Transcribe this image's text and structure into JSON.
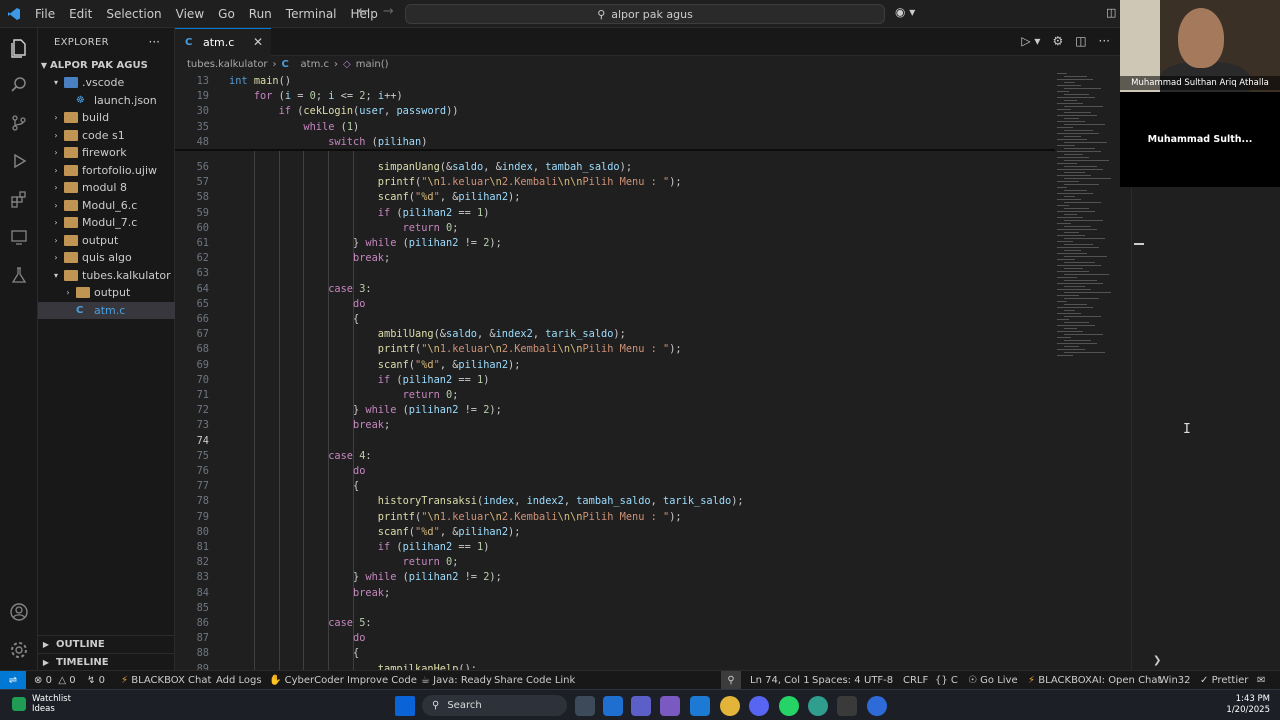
{
  "titlebar": {
    "menu": [
      "File",
      "Edit",
      "Selection",
      "View",
      "Go",
      "Run",
      "Terminal",
      "Help"
    ],
    "search": "alpor pak agus"
  },
  "explorer": {
    "title": "EXPLORER",
    "workspace": "ALPOR PAK AGUS",
    "items": [
      {
        "label": ".vscode",
        "kind": "vsfolder",
        "depth": 1,
        "expanded": true
      },
      {
        "label": "launch.json",
        "kind": "json",
        "depth": 2
      },
      {
        "label": "build",
        "kind": "folder",
        "depth": 1
      },
      {
        "label": "code s1",
        "kind": "folder",
        "depth": 1
      },
      {
        "label": "firework",
        "kind": "folder",
        "depth": 1
      },
      {
        "label": "fortofolio.ujiw",
        "kind": "folder",
        "depth": 1
      },
      {
        "label": "modul 8",
        "kind": "folder",
        "depth": 1
      },
      {
        "label": "Modul_6.c",
        "kind": "folder",
        "depth": 1
      },
      {
        "label": "Modul_7.c",
        "kind": "folder",
        "depth": 1
      },
      {
        "label": "output",
        "kind": "folder",
        "depth": 1
      },
      {
        "label": "quis algo",
        "kind": "folder",
        "depth": 1
      },
      {
        "label": "tubes.kalkulator",
        "kind": "folder",
        "depth": 1,
        "expanded": true
      },
      {
        "label": "output",
        "kind": "folder",
        "depth": 2
      },
      {
        "label": "atm.c",
        "kind": "c",
        "depth": 2,
        "selected": true
      }
    ],
    "outline": "OUTLINE",
    "timeline": "TIMELINE"
  },
  "tab": {
    "label": "atm.c"
  },
  "breadcrumb": {
    "folder": "tubes.kalkulator",
    "file": "atm.c",
    "symbol": "main()"
  },
  "editor": {
    "current_line": 74,
    "sticky": [
      {
        "n": "13",
        "text": "int main()"
      },
      {
        "n": "19",
        "text": "    for (i = 0; i <= 2; i++)"
      },
      {
        "n": "30",
        "text": "        if (cekLogin(user, password))"
      },
      {
        "n": "35",
        "text": "            while (1)"
      },
      {
        "n": "48",
        "text": "                switch (pilihan)"
      }
    ],
    "lines": [
      {
        "n": "56",
        "text": "                        simpanUang(&saldo, &index, tambah_saldo);"
      },
      {
        "n": "57",
        "text": "                        printf(\"\\n1.keluar\\n2.Kembali\\n\\nPilih Menu : \");"
      },
      {
        "n": "58",
        "text": "                        scanf(\"%d\", &pilihan2);"
      },
      {
        "n": "59",
        "text": "                        if (pilihan2 == 1)"
      },
      {
        "n": "60",
        "text": "                            return 0;"
      },
      {
        "n": "61",
        "text": "                    } while (pilihan2 != 2);"
      },
      {
        "n": "62",
        "text": "                    break;"
      },
      {
        "n": "63",
        "text": ""
      },
      {
        "n": "64",
        "text": "                case 3:"
      },
      {
        "n": "65",
        "text": "                    do"
      },
      {
        "n": "66",
        "text": "                    {"
      },
      {
        "n": "67",
        "text": "                        ambilUang(&saldo, &index2, tarik_saldo);"
      },
      {
        "n": "68",
        "text": "                        printf(\"\\n1.keluar\\n2.Kembali\\n\\nPilih Menu : \");"
      },
      {
        "n": "69",
        "text": "                        scanf(\"%d\", &pilihan2);"
      },
      {
        "n": "70",
        "text": "                        if (pilihan2 == 1)"
      },
      {
        "n": "71",
        "text": "                            return 0;"
      },
      {
        "n": "72",
        "text": "                    } while (pilihan2 != 2);"
      },
      {
        "n": "73",
        "text": "                    break;"
      },
      {
        "n": "74",
        "text": ""
      },
      {
        "n": "75",
        "text": "                case 4:"
      },
      {
        "n": "76",
        "text": "                    do"
      },
      {
        "n": "77",
        "text": "                    {"
      },
      {
        "n": "78",
        "text": "                        historyTransaksi(index, index2, tambah_saldo, tarik_saldo);"
      },
      {
        "n": "79",
        "text": "                        printf(\"\\n1.keluar\\n2.Kembali\\n\\nPilih Menu : \");"
      },
      {
        "n": "80",
        "text": "                        scanf(\"%d\", &pilihan2);"
      },
      {
        "n": "81",
        "text": "                        if (pilihan2 == 1)"
      },
      {
        "n": "82",
        "text": "                            return 0;"
      },
      {
        "n": "83",
        "text": "                    } while (pilihan2 != 2);"
      },
      {
        "n": "84",
        "text": "                    break;"
      },
      {
        "n": "85",
        "text": ""
      },
      {
        "n": "86",
        "text": "                case 5:"
      },
      {
        "n": "87",
        "text": "                    do"
      },
      {
        "n": "88",
        "text": "                    {"
      },
      {
        "n": "89",
        "text": "                        tampilkanHelp();"
      }
    ]
  },
  "webcam": {
    "participant": "Muhammad Sulthan Ariq Athalla",
    "tile_name": "Muhammad  Sulth..."
  },
  "status": {
    "errors": "0",
    "warnings": "0",
    "ports": "0",
    "blackbox_chat": "BLACKBOX Chat",
    "add_logs": "Add Logs",
    "cybercoder": "CyberCoder",
    "improve_code": "Improve Code",
    "java": "Java: Ready",
    "share": "Share Code Link",
    "position": "Ln 74, Col 1",
    "spaces": "Spaces: 4",
    "encoding": "UTF-8",
    "eol": "CRLF",
    "language": "C",
    "golive": "Go Live",
    "blackboxai": "BLACKBOXAI: Open Chat",
    "platform": "Win32",
    "prettier": "Prettier"
  },
  "taskbar": {
    "watchlist": "Watchlist",
    "watchlist_sub": "Ideas",
    "search": "Search",
    "time": "1:43 PM",
    "date": "1/20/2025"
  },
  "colors": {
    "accent": "#0078d4",
    "editor_bg": "#1f1f1f",
    "sidebar_bg": "#181818",
    "keyword": "#c586c0",
    "function": "#dcdcaa",
    "string": "#ce9178",
    "number": "#b5cea8"
  }
}
